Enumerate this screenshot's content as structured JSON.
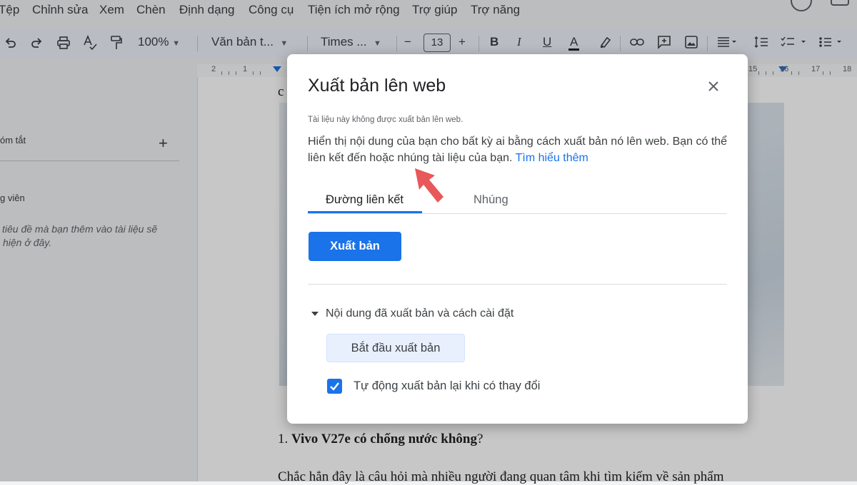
{
  "menu": [
    "Tệp",
    "Chỉnh sửa",
    "Xem",
    "Chèn",
    "Định dạng",
    "Công cụ",
    "Tiện ích mở rộng",
    "Trợ giúp",
    "Trợ năng"
  ],
  "toolbar": {
    "zoom": "100%",
    "style": "Văn bản t...",
    "font": "Times ...",
    "font_size": "13",
    "minus": "−",
    "plus": "+",
    "bold": "B",
    "italic": "I",
    "underline": "U",
    "text_color_letter": "A"
  },
  "ruler": {
    "labels": [
      "2",
      "1",
      "15",
      "16",
      "17",
      "18"
    ]
  },
  "sidebar": {
    "summary_label": "óm tắt",
    "summary_add": "+",
    "outline_label": "g viên",
    "outline_empty_line1": "tiêu đề mà bạn thêm vào tài liệu sẽ",
    "outline_empty_line2": "hiện ở đây."
  },
  "document": {
    "top_fragment": "c",
    "heading_number": "1.",
    "heading_bold": "Vivo V27e có chống nước không",
    "heading_suffix": "?",
    "paragraph": "Chắc hẳn đây là câu hỏi mà nhiều người đang quan tâm khi tìm kiếm về sản phẩm"
  },
  "dialog": {
    "title": "Xuất bản lên web",
    "status": "Tài liệu này không được xuất bản lên web.",
    "description": "Hiển thị nội dung của bạn cho bất kỳ ai bằng cách xuất bản nó lên web. Bạn có thể liên kết đến hoặc nhúng tài liệu của bạn.",
    "learn_more": "Tìm hiểu thêm",
    "tabs": {
      "link": "Đường liên kết",
      "embed": "Nhúng"
    },
    "publish_button": "Xuất bản",
    "section_label": "Nội dung đã xuất bản và cách cài đặt",
    "start_button": "Bắt đầu xuất bản",
    "auto_republish": "Tự động xuất bản lại khi có thay đổi",
    "auto_republish_checked": true
  },
  "colors": {
    "accent": "#1a73e8",
    "annotation_arrow": "#e8575a"
  }
}
